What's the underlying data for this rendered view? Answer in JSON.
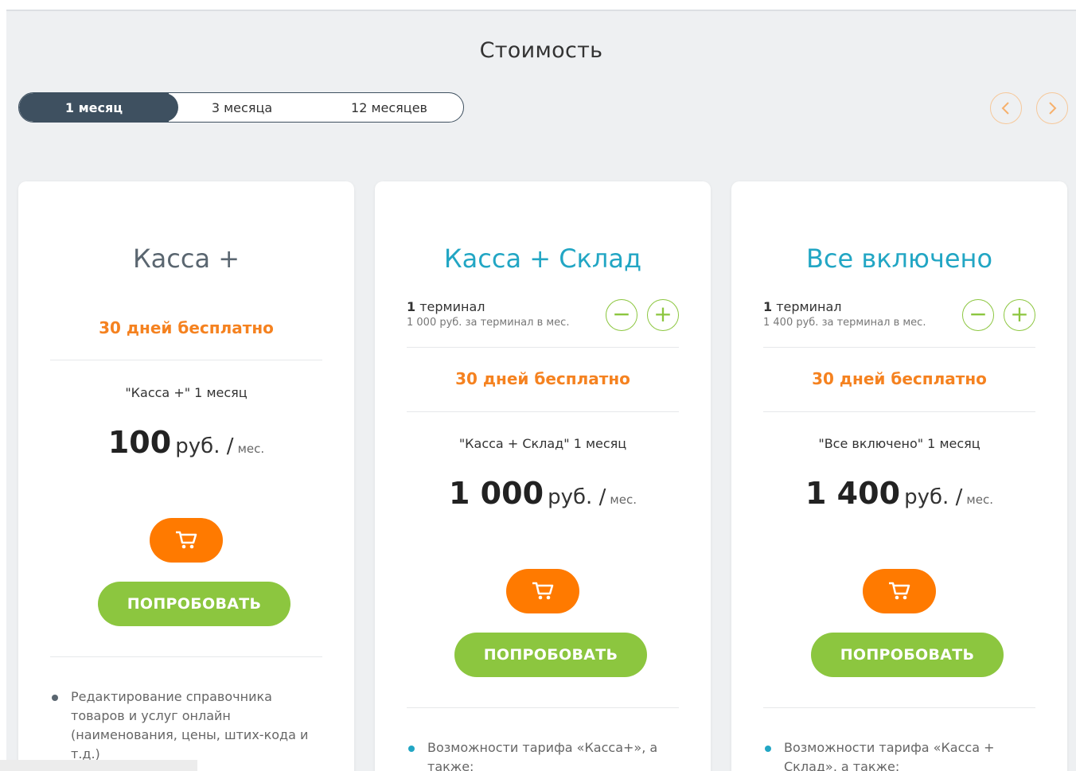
{
  "page": {
    "title": "Стоимость"
  },
  "periods": [
    {
      "label": "1 месяц",
      "active": true
    },
    {
      "label": "3 месяца",
      "active": false
    },
    {
      "label": "12 месяцев",
      "active": false
    }
  ],
  "nav": {
    "prev_icon": "chevron-left-icon",
    "next_icon": "chevron-right-icon"
  },
  "colors": {
    "accent_orange": "#ff7a00",
    "accent_green": "#8cc63f",
    "title_blue": "#22a6c4",
    "dark": "#3e5060"
  },
  "cards": [
    {
      "title": "Касса +",
      "free": "30 дней бесплатно",
      "desc": "\"Касса +\" 1 месяц",
      "amount": "100",
      "currency": "руб. /",
      "per": "мес.",
      "try_label": "ПОПРОБОВАТЬ",
      "feature": "Редактирование справочника товаров и услуг онлайн (наименования, цены, штих-кода и т.д.)"
    },
    {
      "title": "Касса + Склад",
      "terminal_count": "1",
      "terminal_word": " терминал",
      "terminal_price": "1 000 руб. за терминал в мес.",
      "free": "30 дней бесплатно",
      "desc": "\"Касса + Склад\" 1 месяц",
      "amount": "1 000",
      "currency": "руб. /",
      "per": "мес.",
      "try_label": "ПОПРОБОВАТЬ",
      "feature": "Возможности тарифа «Касса+», а также:"
    },
    {
      "title": "Все включено",
      "terminal_count": "1",
      "terminal_word": " терминал",
      "terminal_price": "1 400 руб. за терминал в мес.",
      "free": "30 дней бесплатно",
      "desc": "\"Все включено\" 1 месяц",
      "amount": "1 400",
      "currency": "руб. /",
      "per": "мес.",
      "try_label": "ПОПРОБОВАТЬ",
      "feature": "Возможности тарифа «Касса + Склад», а также:"
    }
  ]
}
